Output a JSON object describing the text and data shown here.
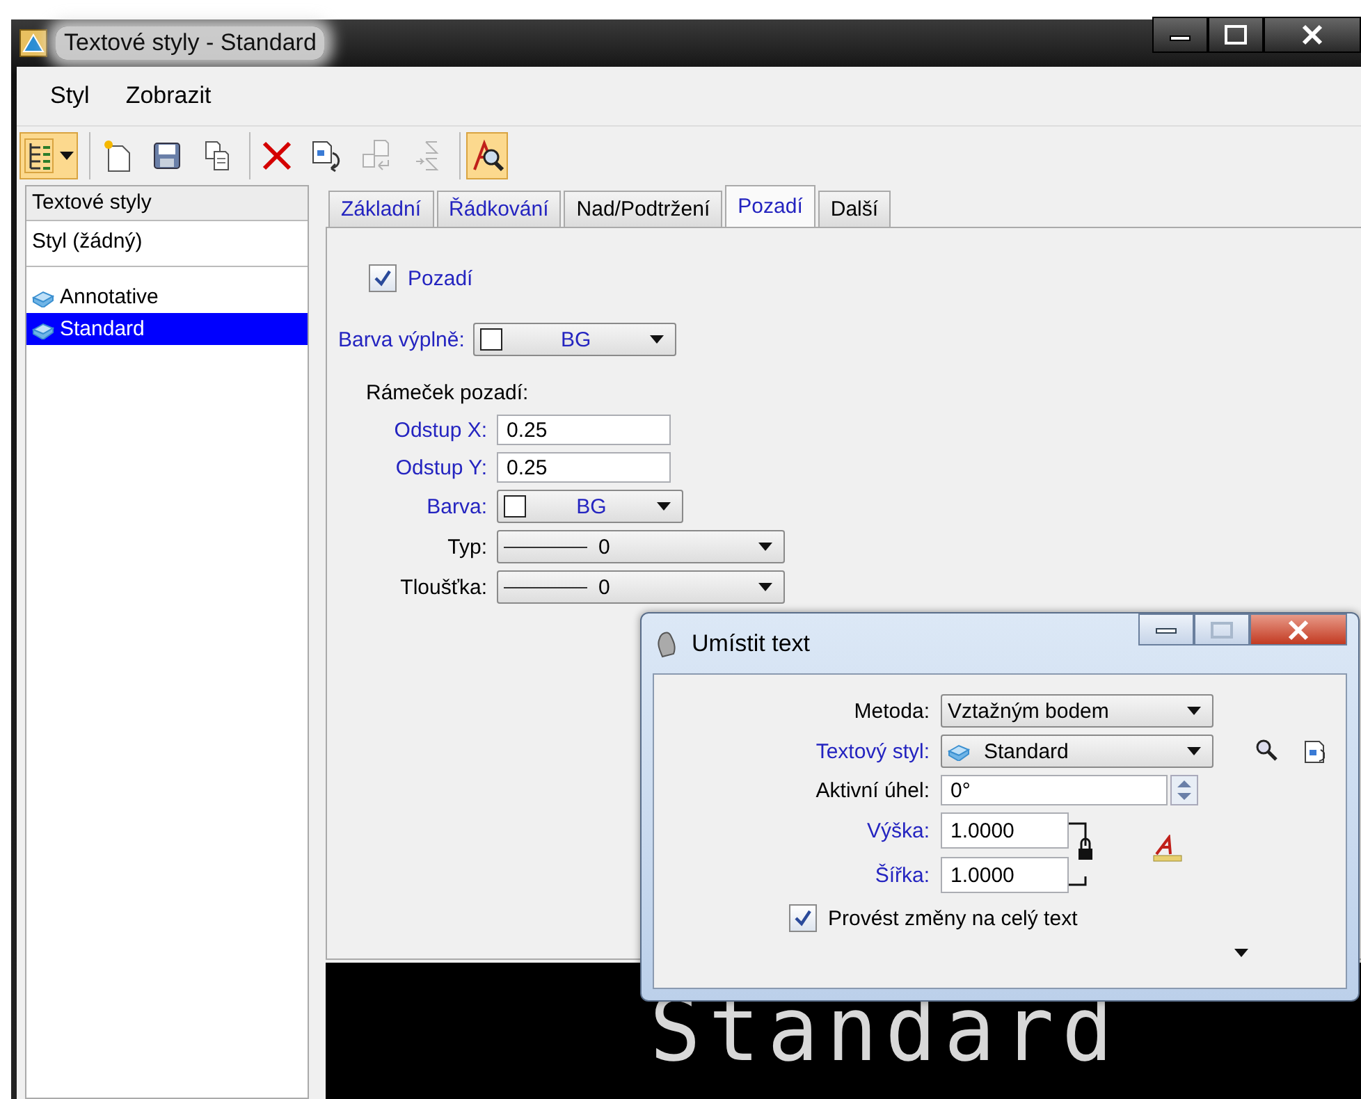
{
  "window": {
    "title": "Textové styly - Standard"
  },
  "menu": [
    "Styl",
    "Zobrazit"
  ],
  "toolbar": [
    [
      {
        "kind": "tree",
        "on": true,
        "disabled": false
      }
    ],
    [
      {
        "kind": "new",
        "on": false,
        "disabled": false
      },
      {
        "kind": "save",
        "on": false,
        "disabled": false
      },
      {
        "kind": "copy",
        "on": false,
        "disabled": false
      }
    ],
    [
      {
        "kind": "delete",
        "on": false,
        "disabled": false
      },
      {
        "kind": "update",
        "on": false,
        "disabled": false
      },
      {
        "kind": "import",
        "on": false,
        "disabled": true
      },
      {
        "kind": "export",
        "on": false,
        "disabled": true
      }
    ],
    [
      {
        "kind": "preview",
        "on": true,
        "disabled": false
      }
    ]
  ],
  "sidebar": {
    "header": "Textové styly",
    "items": [
      {
        "label": "Styl (žádný)",
        "kind": "none",
        "selected": false
      },
      {
        "label": "Annotative",
        "kind": "style",
        "selected": false
      },
      {
        "label": "Standard",
        "kind": "style",
        "selected": true
      }
    ]
  },
  "tabs": [
    {
      "label": "Základní",
      "selected": false,
      "highlighted": true
    },
    {
      "label": "Řádkování",
      "selected": false,
      "highlighted": true
    },
    {
      "label": "Nad/Podtržení",
      "selected": false,
      "highlighted": false
    },
    {
      "label": "Pozadí",
      "selected": true,
      "highlighted": true
    },
    {
      "label": "Další",
      "selected": false,
      "highlighted": false
    }
  ],
  "background": {
    "checkbox": {
      "label": "Pozadí",
      "checked": true,
      "highlighted": true
    },
    "fill_color": {
      "label": "Barva výplně:",
      "value": "BG",
      "highlighted": true
    },
    "frame_heading": "Rámeček pozadí:",
    "fields": [
      {
        "kind": "text",
        "label": "Odstup X:",
        "value": "0.25",
        "highlighted": true
      },
      {
        "kind": "text",
        "label": "Odstup Y:",
        "value": "0.25",
        "highlighted": true
      },
      {
        "kind": "color",
        "label": "Barva:",
        "value": "BG",
        "highlighted": true
      },
      {
        "kind": "line",
        "label": "Typ:",
        "value": "0",
        "highlighted": false
      },
      {
        "kind": "line",
        "label": "Tloušťka:",
        "value": "0",
        "highlighted": false
      }
    ]
  },
  "preview": {
    "text": "Standard"
  },
  "dialog": {
    "title": "Umístit text",
    "fields": [
      {
        "kind": "select",
        "label": "Metoda:",
        "value": "Vztažným bodem",
        "highlighted": false
      },
      {
        "kind": "style_select",
        "label": "Textový styl:",
        "value": "Standard",
        "highlighted": true
      },
      {
        "kind": "spin",
        "label": "Aktivní úhel:",
        "value": "0°",
        "highlighted": false
      }
    ],
    "size_fields": [
      {
        "label": "Výška:",
        "value": "1.0000",
        "highlighted": true
      },
      {
        "label": "Šířka:",
        "value": "1.0000",
        "highlighted": true
      }
    ],
    "checkbox": {
      "label": "Provést změny na celý text",
      "checked": true
    }
  }
}
